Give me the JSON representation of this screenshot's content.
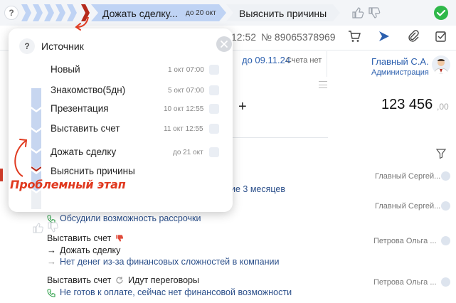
{
  "stagebar": {
    "help": "?",
    "active_stage": "Дожать сделку...",
    "active_due": "до 20 окт",
    "next_stage": "Выяснить причины"
  },
  "header": {
    "time": "12:52",
    "phone": "№ 89065378969"
  },
  "deal": {
    "until": "до 09.11.24",
    "bills": "Счета нет",
    "manager": "Главный С.А.",
    "manager_role": "Администрация",
    "amount": "123 456",
    "amount_decimals": ",00"
  },
  "popup": {
    "help": "?",
    "source_label": "Источник",
    "stages": [
      {
        "name": "Новый",
        "date": "1 окт 07:00"
      },
      {
        "name": "Знакомство(5дн)",
        "date": "5 окт 07:00"
      },
      {
        "name": "Презентация",
        "date": "10 окт 12:55"
      },
      {
        "name": "Выставить счет",
        "date": "11 окт 12:55"
      },
      {
        "name": "Дожать сделку",
        "date": "до 21 окт"
      },
      {
        "name": "Выяснить причины",
        "date": ""
      }
    ]
  },
  "annotation": "Проблемный этап",
  "activities": [
    {
      "text": "ие 3 месяцев",
      "author": ""
    },
    {
      "text": "Обсудили возможность рассрочки",
      "author": ""
    },
    {
      "text": "Выставить счет",
      "author": "Петрова Ольга ..."
    },
    {
      "text": "Дожать сделку",
      "author": ""
    },
    {
      "text": "Нет денег из-за финансовых сложностей в компании",
      "author": ""
    },
    {
      "text": "Выставить счет",
      "author": "Петрова Ольга ..."
    },
    {
      "text": "Идут переговоры",
      "author": ""
    },
    {
      "text": "Не готов к оплате, сейчас нет финансовой возможности",
      "author": ""
    }
  ],
  "authors": [
    "Главный Сергей...",
    "Главный Сергей..."
  ],
  "colors": {
    "accent": "#2b5fae",
    "problem": "#c0392b",
    "stage_active": "#bfd3f4",
    "success": "#2fb84a"
  }
}
